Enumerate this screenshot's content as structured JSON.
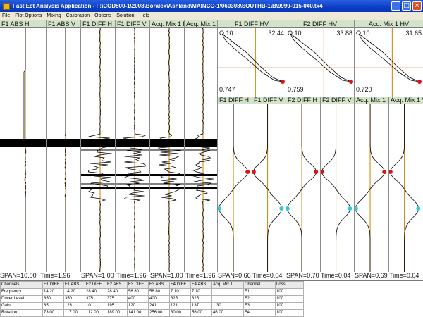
{
  "window": {
    "title": "Fast Ect Analysis Application - F:\\COD500-1\\2008\\Boralex\\Ashland\\MAINCO-1\\060308\\SOUTHB-1\\B\\9999-015-040.tx4",
    "min": "_",
    "max": "□",
    "close": "×"
  },
  "menu": [
    "File",
    "Plot Options",
    "Mixing",
    "Calibration",
    "Options",
    "Solution",
    "Help"
  ],
  "strip_headers": [
    "F1  ABS H",
    "F1  ABS V",
    "F1 DIFF H",
    "F1 DIFF V",
    "Acq. Mix 1 H",
    "Acq. Mix 1 V"
  ],
  "lissajous": [
    {
      "header": "F1 DIFF HV",
      "origin": "O",
      "scale": "10",
      "max": "32.44",
      "min": "0.747"
    },
    {
      "header": "F2 DIFF HV",
      "origin": "O",
      "scale": "10",
      "max": "33.88",
      "min": "0.759"
    },
    {
      "header": "Acq. Mix 1 HV",
      "origin": "O",
      "scale": "10",
      "max": "31.65",
      "min": "0.720"
    }
  ],
  "lower_headers": [
    "F1 DIFF H",
    "F1 DIFF V",
    "F2 DIFF H",
    "F2 DIFF V",
    "Acq. Mix 1 H",
    "Acq. Mix 1 V"
  ],
  "span_labels": [
    "SPAN=10.00",
    "Time=1.96",
    "SPAN=1.00",
    "Time=1.96",
    "SPAN=1.00",
    "Time=1.96",
    "SPAN=0.66",
    "Time=0.04",
    "SPAN=0.70",
    "Time=0.04",
    "SPAN=0.69",
    "Time=0.04"
  ],
  "table": {
    "headers": [
      "Channels",
      "F1 DIFF",
      "F1 ABS",
      "F2 DIFF",
      "F2 ABS",
      "F3 DIFF",
      "F3 ABS",
      "F4 DIFF",
      "F4 ABS",
      "Acq. Mix 1",
      "Channel",
      "Loss"
    ],
    "rows": [
      [
        "Frequency",
        "14.20",
        "14.20",
        "28.40",
        "28.40",
        "56.80",
        "56.80",
        "7.10",
        "7.10",
        "",
        "F1",
        "100  1"
      ],
      [
        "Driver Level",
        "350",
        "350",
        "375",
        "375",
        "400",
        "400",
        "325",
        "325",
        "",
        "F2",
        "100  1"
      ],
      [
        "Gain",
        "85",
        "123",
        "101",
        "195",
        "120",
        "241",
        "121",
        "137",
        "1.30",
        "F3",
        "100  1"
      ],
      [
        "Rotation",
        "73.00",
        "117.00",
        "112.00",
        "189.00",
        "141.00",
        "256.00",
        "30.00",
        "56.00",
        "46.00",
        "F4",
        "100  1"
      ]
    ]
  },
  "colors": {
    "header_bg": "#d3e3c9",
    "trace": "#000000",
    "cursor": "#d08000",
    "red_marker": "#dd1111",
    "cyan_marker": "#33c8d8"
  }
}
